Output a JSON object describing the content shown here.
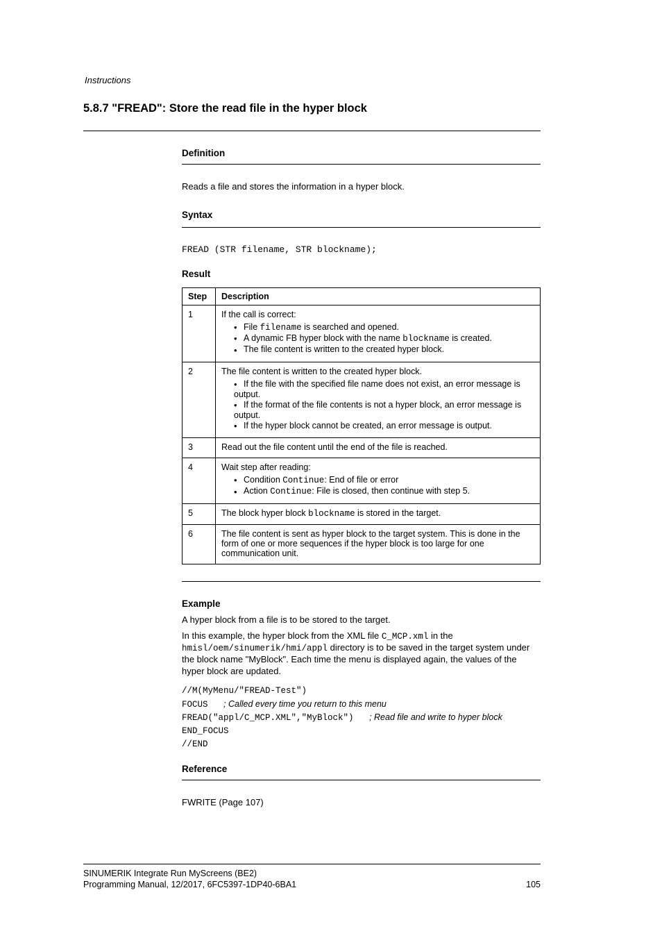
{
  "header": {
    "breadcrumb": "Instructions"
  },
  "heading": "5.8.7 \"FREAD\": Store the read file in the hyper block",
  "definition": {
    "title": "Definition",
    "text": "Reads a file and stores the information in a hyper block."
  },
  "syntax": {
    "title": "Syntax",
    "code": "FREAD (STR filename, STR blockname);"
  },
  "result": {
    "title": "Result",
    "header_step": "Step",
    "header_desc": "Description",
    "rows": [
      {
        "step": "1",
        "intro": "If the call is correct:",
        "bullets": [
          {
            "text": "File <name> is searched and opened.",
            "code": "filename"
          },
          {
            "text": "A dynamic FB hyper block with the name <name> is created.",
            "code": "blockname"
          },
          {
            "text": "The file content is written to the created hyper block."
          }
        ]
      },
      {
        "step": "2",
        "intro": "The file content is written to the created hyper block.",
        "bullets": [
          {
            "text": "If the file with the specified file name does not exist, an error message is output."
          },
          {
            "text": "If the format of the file contents is not a hyper block, an error message is output."
          },
          {
            "text": "If the hyper block cannot be created, an error message is output."
          }
        ]
      },
      {
        "step": "3",
        "intro": "Read out the file content until the end of the file is reached."
      },
      {
        "step": "4",
        "intro": "Wait step after reading:",
        "bullets": [
          {
            "text": "Condition <cond>: End of file or error",
            "code": "Continue"
          },
          {
            "text": "Action <act>: File is closed, then continue with step 5.",
            "code": "Continue"
          }
        ]
      },
      {
        "step": "5",
        "intro": "The block hyper block <name> is stored in the target.",
        "code": "blockname"
      },
      {
        "step": "6",
        "intro": "The file content is sent as hyper block to the target system. This is done in the form of one or more sequences if the hyper block is too large for one communication unit."
      }
    ]
  },
  "example": {
    "title": "Example",
    "para1": "A hyper block from a file is to be stored to the target.",
    "para2_prefix": "In this example, the hyper block from the XML file ",
    "para2_file": "C_MCP.xml",
    "para2_mid": " in the ",
    "para2_dir": "hmisl/oem/sinumerik/hmi/appl",
    "para2_suffix": " directory is to be saved in the target system under the block name \"MyBlock\". Each time the menu is displayed again, the values of the hyper block are updated.",
    "code_lines": [
      {
        "text": "//M(MyMenu/\"FREAD-Test\")"
      },
      {
        "text": "FOCUS",
        "comment": "; Called every time you return to this menu"
      },
      {
        "text": "   FREAD(\"appl/C_MCP.XML\",\"MyBlock\")",
        "comment": "; Read file and write to hyper block"
      },
      {
        "text": "END_FOCUS"
      },
      {
        "text": "//END"
      }
    ]
  },
  "reference": {
    "title": "Reference",
    "text": "FWRITE (Page 107)"
  },
  "footer": {
    "left": "SINUMERIK Integrate Run MyScreens (BE2)",
    "right": "",
    "line2_left": "Programming Manual, 12/2017, 6FC5397-1DP40-6BA1",
    "line2_right": "105"
  }
}
